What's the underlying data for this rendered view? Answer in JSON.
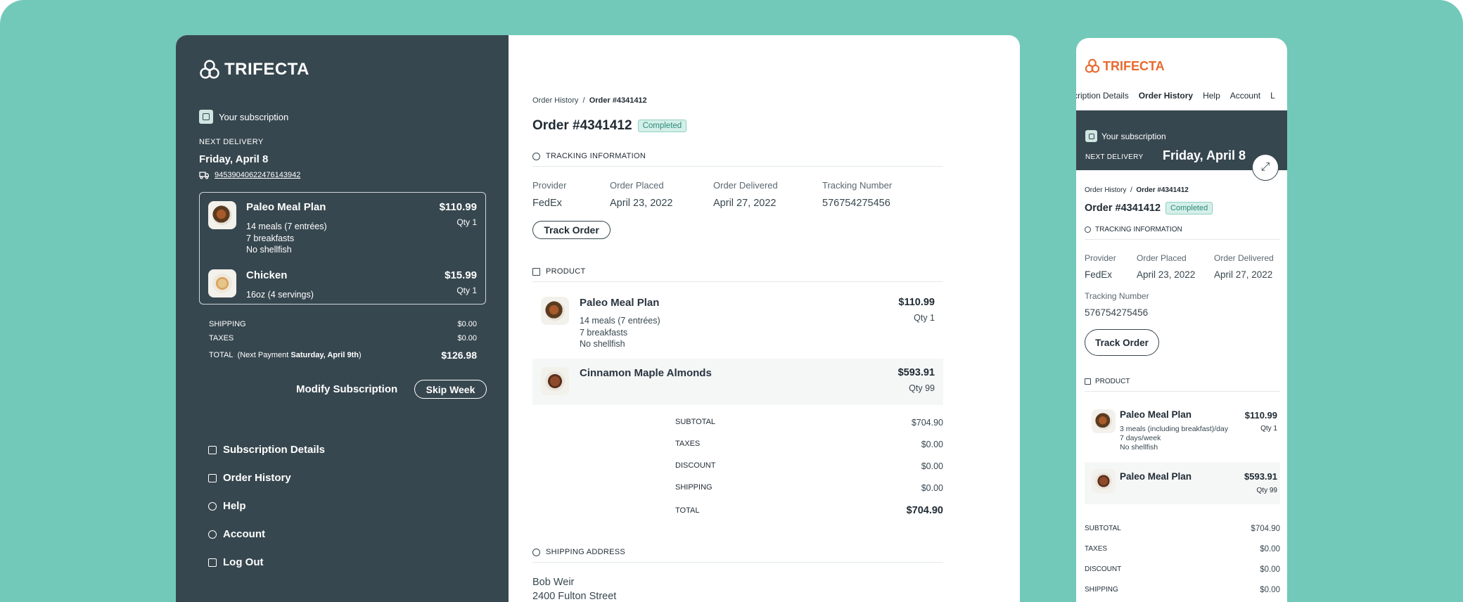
{
  "brand": "TRIFECTA",
  "colors": {
    "background": "#72c9b9",
    "sidebar": "#37474f",
    "accent_orange": "#e86a2e",
    "badge_bg": "#d4efe9"
  },
  "sidebar": {
    "subscription_label": "Your subscription",
    "next_delivery_label": "NEXT DELIVERY",
    "next_delivery_date": "Friday, April 8",
    "tracking_number": "94539040622476143942",
    "items": [
      {
        "name": "Paleo Meal Plan",
        "price": "$110.99",
        "qty": "Qty 1",
        "details": [
          "14 meals (7 entrées)",
          "7 breakfasts",
          "No shellfish"
        ]
      },
      {
        "name": "Chicken",
        "price": "$15.99",
        "qty": "Qty 1",
        "details": [
          "16oz (4 servings)"
        ]
      }
    ],
    "shipping_label": "SHIPPING",
    "shipping_value": "$0.00",
    "taxes_label": "TAXES",
    "taxes_value": "$0.00",
    "total_label": "TOTAL",
    "next_payment_prefix": "(Next Payment ",
    "next_payment_date": "Saturday, April 9th",
    "next_payment_suffix": ")",
    "total_value": "$126.98",
    "modify_label": "Modify Subscription",
    "skip_label": "Skip Week",
    "nav": [
      "Subscription Details",
      "Order History",
      "Help",
      "Account",
      "Log Out"
    ]
  },
  "main": {
    "breadcrumb_parent": "Order History",
    "breadcrumb_sep": "/",
    "breadcrumb_current": "Order #4341412",
    "order_title": "Order #4341412",
    "status": "Completed",
    "tracking_heading": "TRACKING INFORMATION",
    "tracking": [
      {
        "label": "Provider",
        "value": "FedEx"
      },
      {
        "label": "Order Placed",
        "value": "April 23, 2022"
      },
      {
        "label": "Order Delivered",
        "value": "April 27, 2022"
      },
      {
        "label": "Tracking Number",
        "value": "576754275456"
      }
    ],
    "track_button": "Track Order",
    "product_heading": "PRODUCT",
    "products": [
      {
        "name": "Paleo Meal Plan",
        "price": "$110.99",
        "qty": "Qty 1",
        "details": [
          "14 meals (7 entrées)",
          "7 breakfasts",
          "No shellfish"
        ]
      },
      {
        "name": "Cinnamon Maple Almonds",
        "price": "$593.91",
        "qty": "Qty 99",
        "details": []
      }
    ],
    "totals": [
      {
        "label": "SUBTOTAL",
        "value": "$704.90"
      },
      {
        "label": "TAXES",
        "value": "$0.00"
      },
      {
        "label": "DISCOUNT",
        "value": "$0.00"
      },
      {
        "label": "SHIPPING",
        "value": "$0.00"
      },
      {
        "label": "TOTAL",
        "value": "$704.90"
      }
    ],
    "shipping_heading": "SHIPPING ADDRESS",
    "address_name": "Bob Weir",
    "address_street": "2400 Fulton Street"
  },
  "mobile": {
    "tabs": [
      "scription Details",
      "Order History",
      "Help",
      "Account",
      "L"
    ],
    "subscription_label": "Your subscription",
    "next_delivery_label": "NEXT DELIVERY",
    "next_delivery_date": "Friday, April 8",
    "tracking_number_label": "Tracking Number",
    "products": [
      {
        "name": "Paleo Meal Plan",
        "price": "$110.99",
        "qty": "Qty 1",
        "details": [
          "3 meals (including breakfast)/day",
          "7 days/week",
          "No shellfish"
        ]
      },
      {
        "name": "Paleo Meal Plan",
        "price": "$593.91",
        "qty": "Qty 99",
        "details": []
      }
    ],
    "totals": [
      {
        "label": "SUBTOTAL",
        "value": "$704.90"
      },
      {
        "label": "TAXES",
        "value": "$0.00"
      },
      {
        "label": "DISCOUNT",
        "value": "$0.00"
      },
      {
        "label": "SHIPPING",
        "value": "$0.00"
      }
    ]
  }
}
